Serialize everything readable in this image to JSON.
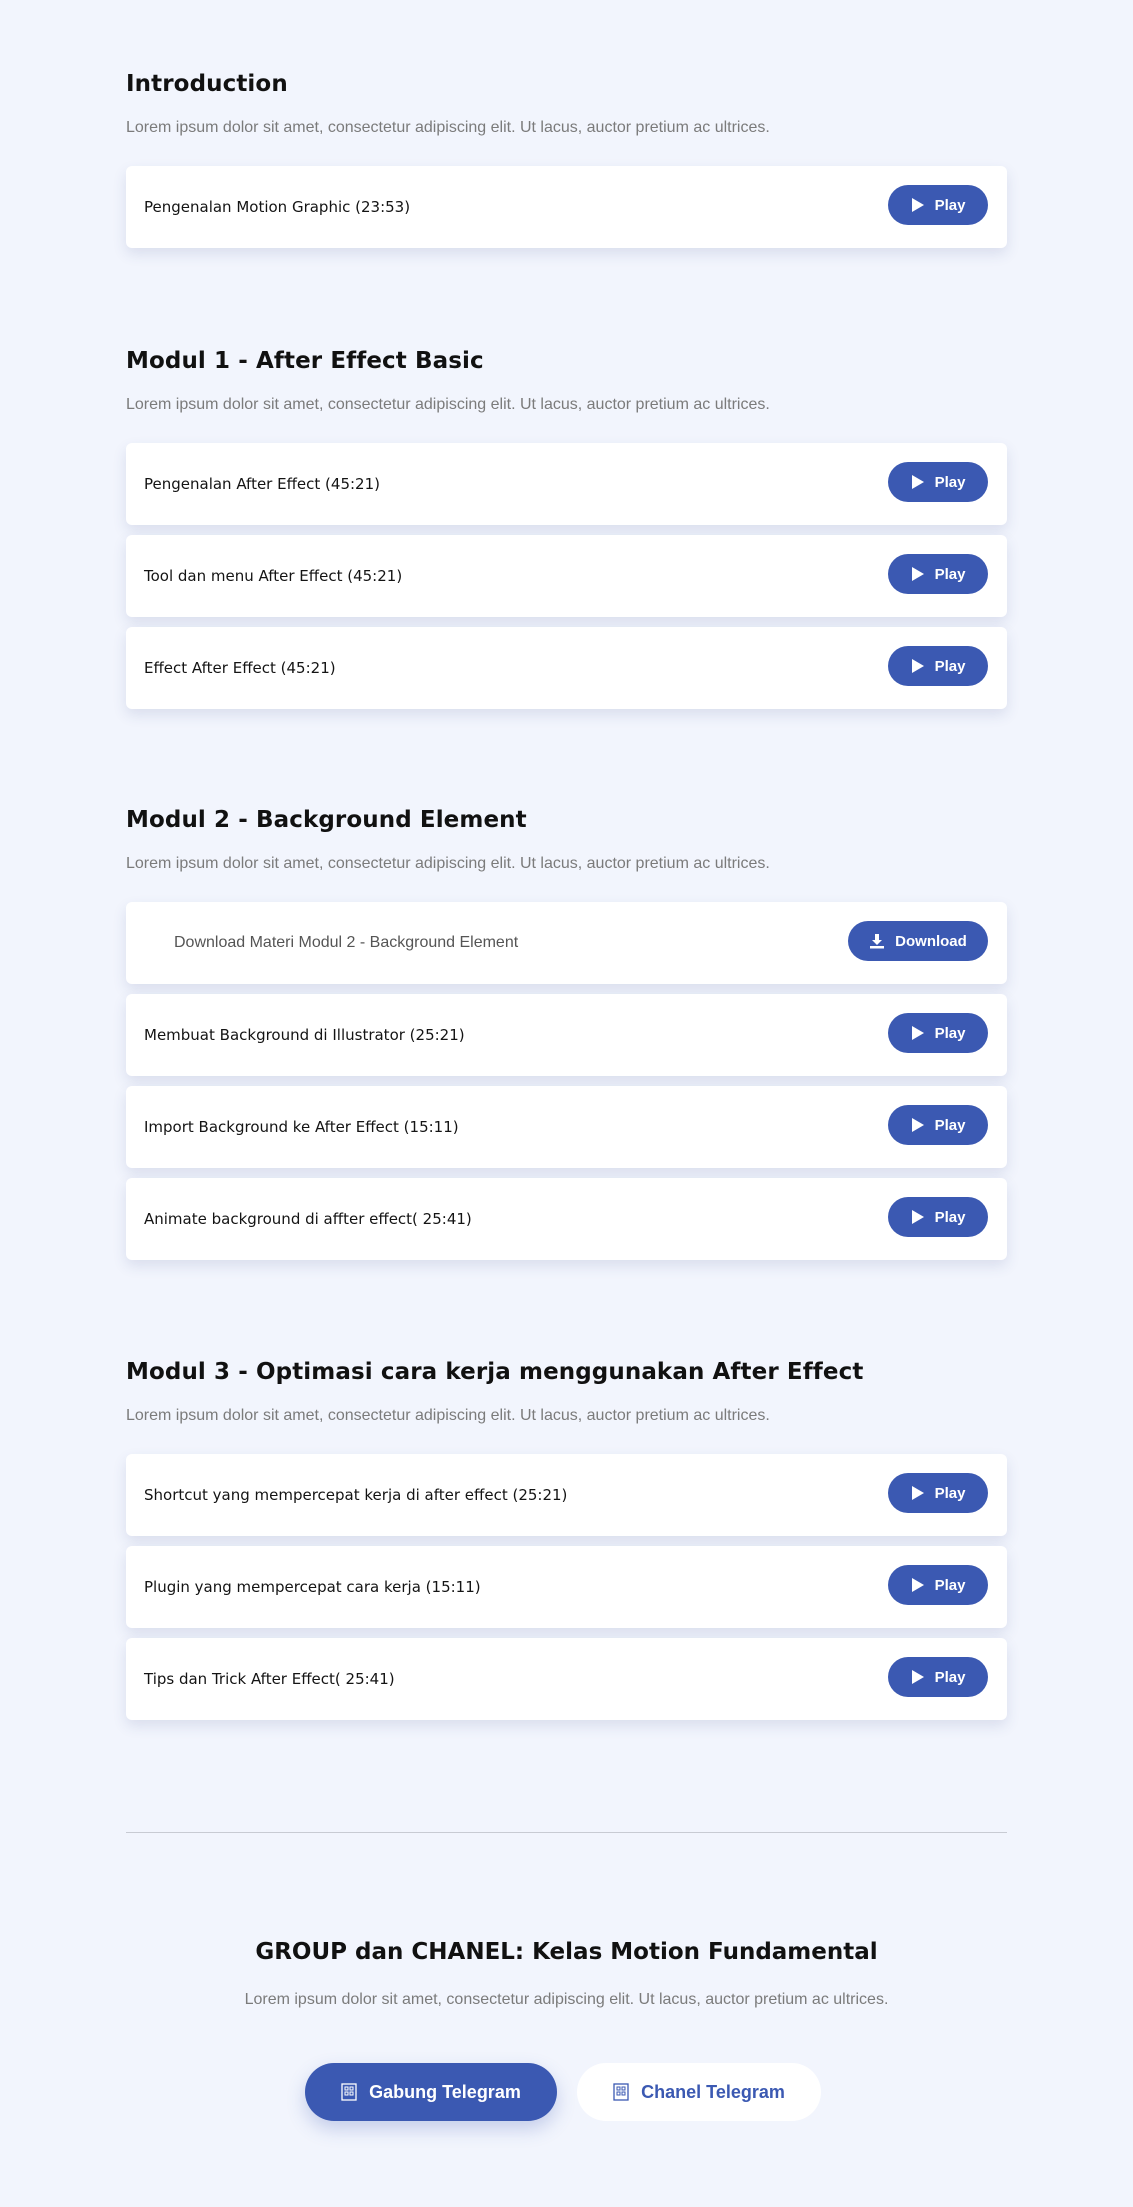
{
  "sections": [
    {
      "title": "Introduction",
      "description": "Lorem ipsum dolor sit amet, consectetur adipiscing elit. Ut lacus, auctor pretium ac ultrices.",
      "lessons": [
        {
          "label": "Pengenalan Motion Graphic (23:53)",
          "button": "Play"
        }
      ]
    },
    {
      "title": "Modul 1 - After Effect Basic",
      "description": "Lorem ipsum dolor sit amet, consectetur adipiscing elit. Ut lacus, auctor pretium ac ultrices.",
      "lessons": [
        {
          "label": "Pengenalan After Effect (45:21)",
          "button": "Play"
        },
        {
          "label": "Tool dan menu After Effect (45:21)",
          "button": "Play"
        },
        {
          "label": "Effect After Effect (45:21)",
          "button": "Play"
        }
      ]
    },
    {
      "title": "Modul 2 - Background Element",
      "description": "Lorem ipsum dolor sit amet, consectetur adipiscing elit. Ut lacus, auctor pretium ac ultrices.",
      "download": {
        "label": "Download Materi Modul 2 - Background Element",
        "button": "Download"
      },
      "lessons": [
        {
          "label": "Membuat Background di Illustrator (25:21)",
          "button": "Play"
        },
        {
          "label": "Import Background ke After Effect (15:11)",
          "button": "Play"
        },
        {
          "label": "Animate background di affter effect( 25:41)",
          "button": "Play"
        }
      ]
    },
    {
      "title": "Modul 3 - Optimasi cara kerja menggunakan After Effect",
      "description": "Lorem ipsum dolor sit amet, consectetur adipiscing elit. Ut lacus, auctor pretium ac ultrices.",
      "lessons": [
        {
          "label": "Shortcut yang mempercepat kerja di after effect (25:21)",
          "button": "Play"
        },
        {
          "label": "Plugin yang mempercepat cara kerja (15:11)",
          "button": "Play"
        },
        {
          "label": "Tips dan Trick After Effect( 25:41)",
          "button": "Play"
        }
      ]
    }
  ],
  "footer": {
    "title": "GROUP dan CHANEL: Kelas Motion Fundamental",
    "description": "Lorem ipsum dolor sit amet, consectetur adipiscing elit. Ut lacus, auctor pretium ac ultrices.",
    "primary_button": "Gabung Telegram",
    "secondary_button": "Chanel Telegram"
  },
  "icons": {
    "play": "play-icon",
    "download": "download-icon",
    "telegram": "telegram-icon"
  },
  "colors": {
    "accent": "#3b59b2",
    "background": "#f2f5fd",
    "card": "#ffffff",
    "muted_text": "#7b7b7b"
  }
}
